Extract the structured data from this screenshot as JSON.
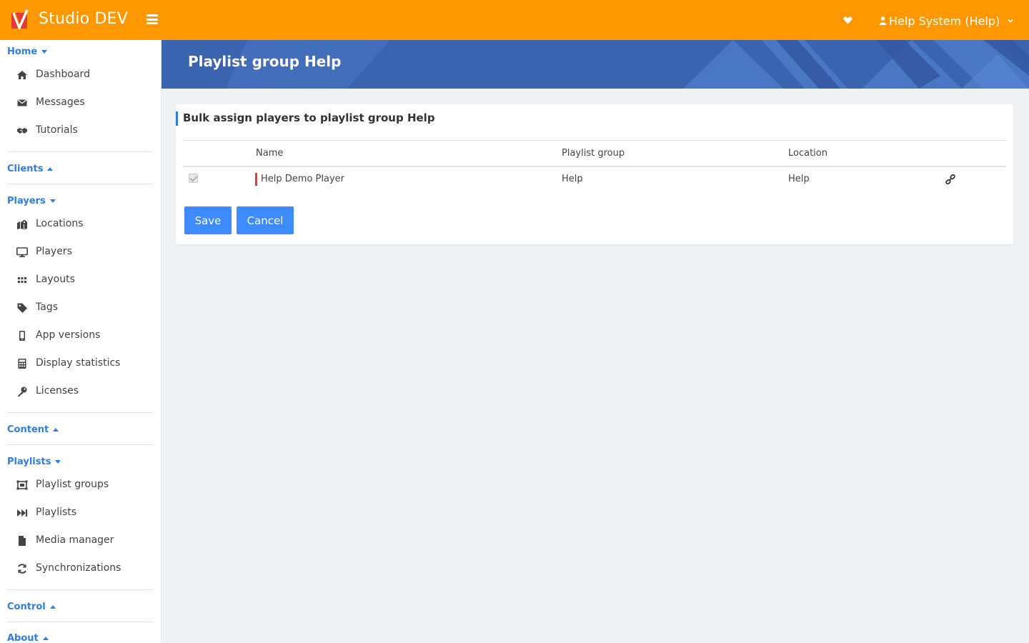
{
  "app": {
    "title": "Studio DEV",
    "accent_color": "#ff9800",
    "user_label": "Help System (Help)"
  },
  "sidebar": {
    "sections": [
      {
        "label": "Home",
        "expanded": true,
        "items": [
          {
            "label": "Dashboard",
            "icon": "home-icon"
          },
          {
            "label": "Messages",
            "icon": "envelope-icon"
          },
          {
            "label": "Tutorials",
            "icon": "handshake-icon"
          }
        ]
      },
      {
        "label": "Clients",
        "expanded": false,
        "items": []
      },
      {
        "label": "Players",
        "expanded": true,
        "items": [
          {
            "label": "Locations",
            "icon": "map-marker-icon"
          },
          {
            "label": "Players",
            "icon": "monitor-icon"
          },
          {
            "label": "Layouts",
            "icon": "grid-icon"
          },
          {
            "label": "Tags",
            "icon": "tag-icon"
          },
          {
            "label": "App versions",
            "icon": "mobile-icon"
          },
          {
            "label": "Display statistics",
            "icon": "calculator-icon"
          },
          {
            "label": "Licenses",
            "icon": "key-icon"
          }
        ]
      },
      {
        "label": "Content",
        "expanded": false,
        "items": []
      },
      {
        "label": "Playlists",
        "expanded": true,
        "items": [
          {
            "label": "Playlist groups",
            "icon": "object-group-icon"
          },
          {
            "label": "Playlists",
            "icon": "fast-forward-icon"
          },
          {
            "label": "Media manager",
            "icon": "file-icon"
          },
          {
            "label": "Synchronizations",
            "icon": "sync-icon"
          }
        ]
      },
      {
        "label": "Control",
        "expanded": false,
        "items": []
      },
      {
        "label": "About",
        "expanded": false,
        "items": []
      }
    ]
  },
  "banner": {
    "title": "Playlist group Help",
    "color": "#3a63b0"
  },
  "card": {
    "title": "Bulk assign players to playlist group Help",
    "columns": [
      "Name",
      "Playlist group",
      "Location"
    ],
    "rows": [
      {
        "checked": true,
        "name": "Help Demo Player",
        "playlist_group": "Help",
        "location": "Help",
        "status_color": "#e53935"
      }
    ],
    "save_label": "Save",
    "cancel_label": "Cancel",
    "button_color": "#3d8bfd"
  }
}
